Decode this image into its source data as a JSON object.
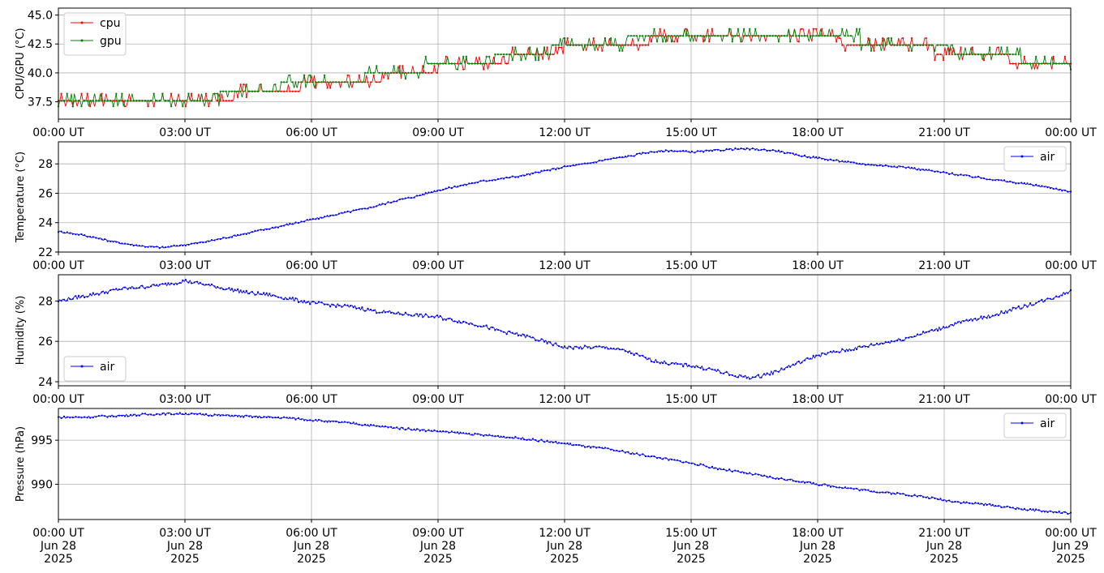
{
  "chart_data": [
    {
      "type": "line",
      "ylabel": "CPU/GPU (°C)",
      "ylim": [
        36.0,
        45.6
      ],
      "yticks": [
        "37.5",
        "40.0",
        "42.5",
        "45.0"
      ],
      "ytick_values": [
        37.5,
        40.0,
        42.5,
        45.0
      ],
      "xlim_hours": [
        0,
        24
      ],
      "xticks": [
        "00:00 UT",
        "03:00 UT",
        "06:00 UT",
        "09:00 UT",
        "12:00 UT",
        "15:00 UT",
        "18:00 UT",
        "21:00 UT",
        "00:00 UT"
      ],
      "grid": true,
      "legend": "top-left",
      "series": [
        {
          "name": "cpu",
          "color": "#ff0000",
          "x_hours": [
            0,
            0.5,
            1,
            1.5,
            2,
            2.5,
            3,
            3.5,
            4,
            4.5,
            5,
            5.5,
            6,
            6.5,
            7,
            7.5,
            8,
            8.5,
            9,
            9.5,
            10,
            10.5,
            11,
            11.5,
            12,
            12.5,
            13,
            13.5,
            14,
            14.5,
            15,
            15.5,
            16,
            16.5,
            17,
            17.5,
            18,
            18.5,
            19,
            19.5,
            20,
            20.5,
            21,
            21.5,
            22,
            22.5,
            23,
            23.5,
            24
          ],
          "values": [
            37.6,
            37.5,
            37.4,
            37.3,
            37.3,
            37.3,
            37.4,
            37.6,
            37.9,
            38.2,
            38.5,
            38.7,
            38.9,
            39.1,
            39.3,
            39.5,
            39.8,
            40.1,
            40.4,
            40.7,
            40.9,
            41.1,
            41.4,
            41.7,
            42.0,
            42.2,
            42.4,
            42.6,
            42.8,
            43.0,
            43.1,
            43.2,
            43.3,
            43.3,
            43.2,
            43.1,
            42.9,
            42.8,
            42.6,
            42.5,
            42.3,
            42.1,
            41.9,
            41.7,
            41.4,
            41.2,
            40.9,
            40.7,
            40.5
          ]
        },
        {
          "name": "gpu",
          "color": "#008000",
          "x_hours": [
            0,
            0.5,
            1,
            1.5,
            2,
            2.5,
            3,
            3.5,
            4,
            4.5,
            5,
            5.5,
            6,
            6.5,
            7,
            7.5,
            8,
            8.5,
            9,
            9.5,
            10,
            10.5,
            11,
            11.5,
            12,
            12.5,
            13,
            13.5,
            14,
            14.5,
            15,
            15.5,
            16,
            16.5,
            17,
            17.5,
            18,
            18.5,
            19,
            19.5,
            20,
            20.5,
            21,
            21.5,
            22,
            22.5,
            23,
            23.5,
            24
          ],
          "values": [
            37.9,
            37.6,
            37.5,
            37.4,
            37.3,
            37.4,
            37.5,
            37.8,
            38.1,
            38.4,
            38.7,
            38.9,
            39.1,
            39.3,
            39.5,
            39.7,
            40.0,
            40.3,
            40.6,
            40.8,
            41.0,
            41.3,
            41.6,
            41.9,
            42.2,
            42.4,
            42.6,
            42.8,
            43.0,
            43.1,
            43.2,
            43.3,
            43.4,
            43.4,
            43.3,
            43.2,
            43.0,
            42.9,
            42.8,
            42.7,
            42.5,
            42.3,
            42.1,
            41.9,
            41.6,
            41.4,
            41.1,
            40.9,
            40.7
          ]
        }
      ]
    },
    {
      "type": "line",
      "ylabel": "Temperature (°C)",
      "ylim": [
        22.0,
        29.5
      ],
      "yticks": [
        "22",
        "24",
        "26",
        "28"
      ],
      "ytick_values": [
        22,
        24,
        26,
        28
      ],
      "xlim_hours": [
        0,
        24
      ],
      "xticks": [
        "00:00 UT",
        "03:00 UT",
        "06:00 UT",
        "09:00 UT",
        "12:00 UT",
        "15:00 UT",
        "18:00 UT",
        "21:00 UT",
        "00:00 UT"
      ],
      "grid": true,
      "legend": "top-right",
      "series": [
        {
          "name": "air",
          "color": "#0000ff",
          "x_hours": [
            0,
            0.5,
            1,
            1.5,
            2,
            2.5,
            3,
            3.5,
            4,
            4.5,
            5,
            5.5,
            6,
            6.5,
            7,
            7.5,
            8,
            8.5,
            9,
            9.5,
            10,
            10.5,
            11,
            11.5,
            12,
            12.5,
            13,
            13.5,
            14,
            14.5,
            15,
            15.5,
            16,
            16.5,
            17,
            17.5,
            18,
            18.5,
            19,
            19.5,
            20,
            20.5,
            21,
            21.5,
            22,
            22.5,
            23,
            23.5,
            24
          ],
          "values": [
            23.4,
            23.2,
            22.9,
            22.6,
            22.4,
            22.3,
            22.5,
            22.7,
            23.0,
            23.3,
            23.6,
            23.9,
            24.2,
            24.5,
            24.8,
            25.1,
            25.5,
            25.8,
            26.2,
            26.5,
            26.8,
            27.0,
            27.2,
            27.5,
            27.8,
            28.0,
            28.3,
            28.5,
            28.8,
            28.9,
            28.8,
            28.9,
            29.0,
            29.0,
            28.9,
            28.6,
            28.4,
            28.2,
            28.0,
            27.9,
            27.8,
            27.6,
            27.4,
            27.2,
            27.0,
            26.8,
            26.6,
            26.4,
            26.1
          ]
        }
      ]
    },
    {
      "type": "line",
      "ylabel": "Humidity (%)",
      "ylim": [
        23.8,
        29.3
      ],
      "yticks": [
        "24",
        "26",
        "28"
      ],
      "ytick_values": [
        24,
        26,
        28
      ],
      "xlim_hours": [
        0,
        24
      ],
      "xticks": [
        "00:00 UT",
        "03:00 UT",
        "06:00 UT",
        "09:00 UT",
        "12:00 UT",
        "15:00 UT",
        "18:00 UT",
        "21:00 UT",
        "00:00 UT"
      ],
      "grid": true,
      "legend": "bottom-left",
      "series": [
        {
          "name": "air",
          "color": "#0000ff",
          "x_hours": [
            0,
            0.5,
            1,
            1.5,
            2,
            2.5,
            3,
            3.5,
            4,
            4.5,
            5,
            5.5,
            6,
            6.5,
            7,
            7.5,
            8,
            8.5,
            9,
            9.5,
            10,
            10.5,
            11,
            11.5,
            12,
            12.5,
            13,
            13.5,
            14,
            14.5,
            15,
            15.5,
            16,
            16.5,
            17,
            17.5,
            18,
            18.5,
            19,
            19.5,
            20,
            20.5,
            21,
            21.5,
            22,
            22.5,
            23,
            23.5,
            24
          ],
          "values": [
            28.0,
            28.2,
            28.4,
            28.6,
            28.7,
            28.8,
            29.0,
            28.8,
            28.6,
            28.4,
            28.3,
            28.1,
            27.9,
            27.8,
            27.7,
            27.5,
            27.4,
            27.3,
            27.2,
            27.0,
            26.8,
            26.5,
            26.3,
            26.0,
            25.7,
            25.7,
            25.7,
            25.5,
            25.1,
            24.9,
            24.8,
            24.6,
            24.3,
            24.2,
            24.5,
            24.9,
            25.3,
            25.5,
            25.7,
            25.9,
            26.1,
            26.4,
            26.7,
            27.0,
            27.2,
            27.5,
            27.8,
            28.1,
            28.5
          ]
        }
      ]
    },
    {
      "type": "line",
      "ylabel": "Pressure (hPa)",
      "ylim": [
        986.0,
        998.6
      ],
      "yticks": [
        "990",
        "995"
      ],
      "ytick_values": [
        990,
        995
      ],
      "xlim_hours": [
        0,
        24
      ],
      "xticks": [
        "00:00 UT\nJun 28\n2025",
        "03:00 UT\nJun 28\n2025",
        "06:00 UT\nJun 28\n2025",
        "09:00 UT\nJun 28\n2025",
        "12:00 UT\nJun 28\n2025",
        "15:00 UT\nJun 28\n2025",
        "18:00 UT\nJun 28\n2025",
        "21:00 UT\nJun 28\n2025",
        "00:00 UT\nJun 29\n2025"
      ],
      "grid": true,
      "legend": "top-right",
      "series": [
        {
          "name": "air",
          "color": "#0000ff",
          "x_hours": [
            0,
            0.5,
            1,
            1.5,
            2,
            2.5,
            3,
            3.5,
            4,
            4.5,
            5,
            5.5,
            6,
            6.5,
            7,
            7.5,
            8,
            8.5,
            9,
            9.5,
            10,
            10.5,
            11,
            11.5,
            12,
            12.5,
            13,
            13.5,
            14,
            14.5,
            15,
            15.5,
            16,
            16.5,
            17,
            17.5,
            18,
            18.5,
            19,
            19.5,
            20,
            20.5,
            21,
            21.5,
            22,
            22.5,
            23,
            23.5,
            24
          ],
          "values": [
            997.6,
            997.6,
            997.7,
            997.8,
            997.9,
            998.0,
            998.0,
            997.9,
            997.8,
            997.7,
            997.6,
            997.5,
            997.3,
            997.1,
            996.9,
            996.6,
            996.4,
            996.2,
            996.0,
            995.8,
            995.6,
            995.4,
            995.2,
            994.9,
            994.6,
            994.3,
            994.0,
            993.6,
            993.2,
            992.8,
            992.4,
            991.9,
            991.5,
            991.1,
            990.7,
            990.4,
            990.0,
            989.7,
            989.4,
            989.1,
            988.9,
            988.6,
            988.2,
            987.9,
            987.7,
            987.4,
            987.1,
            986.9,
            986.7
          ]
        }
      ]
    }
  ]
}
